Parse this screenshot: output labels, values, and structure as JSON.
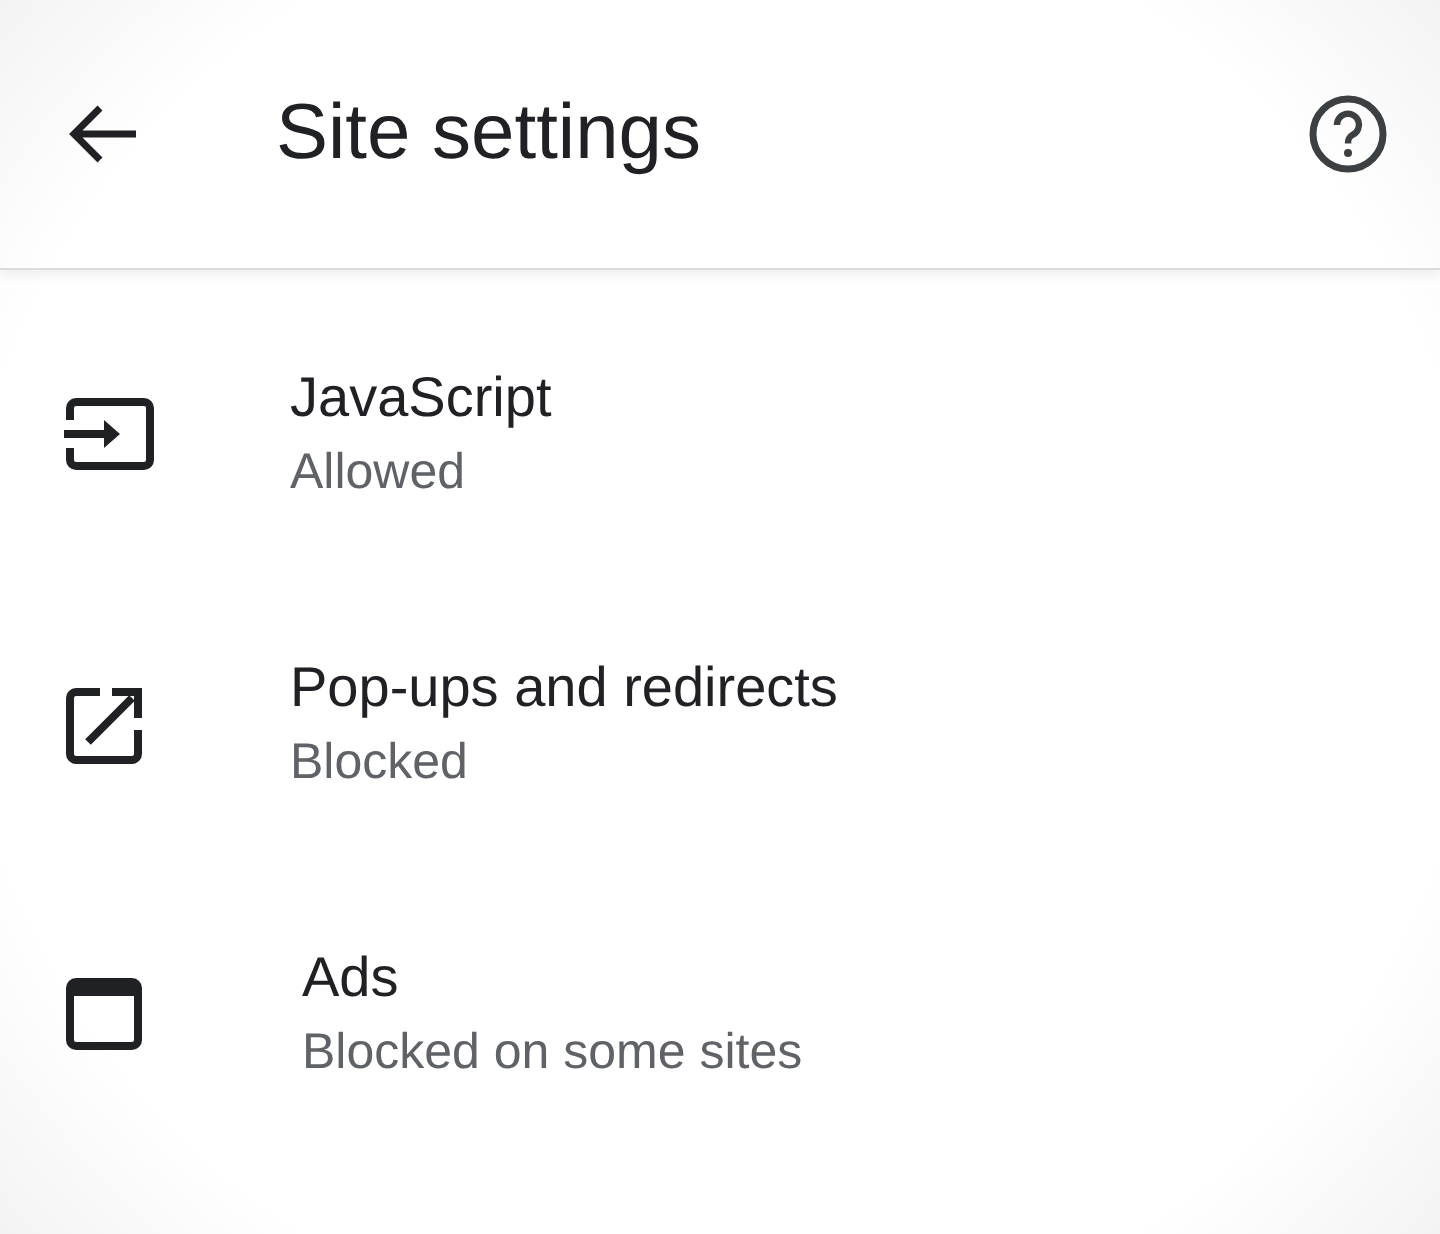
{
  "header": {
    "title": "Site settings"
  },
  "settings": [
    {
      "kind": "input",
      "title": "JavaScript",
      "status": "Allowed"
    },
    {
      "kind": "popup",
      "title": "Pop-ups and redirects",
      "status": "Blocked"
    },
    {
      "kind": "window",
      "title": "Ads",
      "status": "Blocked on some sites"
    }
  ]
}
